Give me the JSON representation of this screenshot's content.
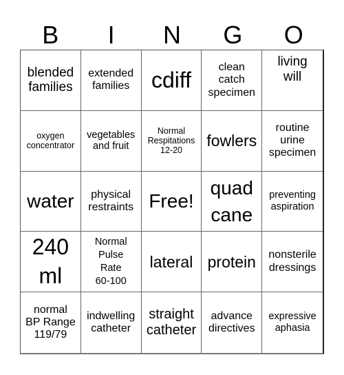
{
  "card": {
    "header_letters": [
      "B",
      "I",
      "N",
      "G",
      "O"
    ],
    "cells": [
      [
        "blended\nfamilies",
        "extended\nfamilies",
        "cdiff",
        "clean\ncatch\nspecimen",
        "living\nwill"
      ],
      [
        "oxygen\nconcentrator",
        "vegetables\nand fruit",
        "Normal\nRespitations\n12-20",
        "fowlers",
        "routine\nurine\nspecimen"
      ],
      [
        "water",
        "physical\nrestraints",
        "Free!",
        "quad\ncane",
        "preventing\naspiration"
      ],
      [
        "240\nml",
        "Normal\nPulse\nRate\n60-100",
        "lateral",
        "protein",
        "nonsterile\ndressings"
      ],
      [
        "normal\nBP Range\n119/79",
        "indwelling\ncatheter",
        "straight\ncatheter",
        "advance\ndirectives",
        "expressive\naphasia"
      ]
    ]
  }
}
